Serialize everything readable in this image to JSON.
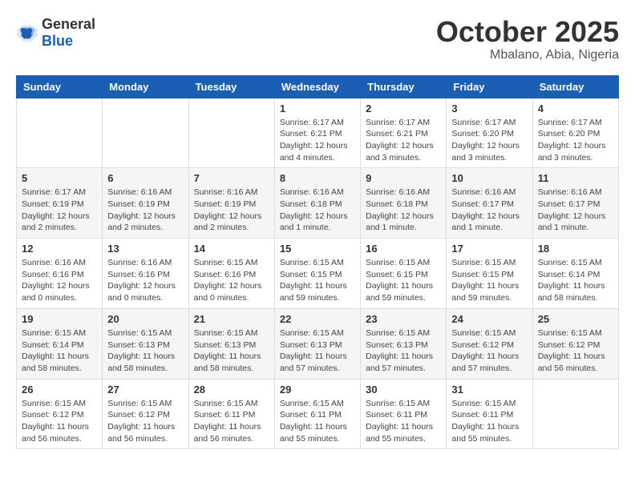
{
  "header": {
    "logo": {
      "general": "General",
      "blue": "Blue"
    },
    "title": "October 2025",
    "location": "Mbalano, Abia, Nigeria"
  },
  "calendar": {
    "weekdays": [
      "Sunday",
      "Monday",
      "Tuesday",
      "Wednesday",
      "Thursday",
      "Friday",
      "Saturday"
    ],
    "weeks": [
      [
        null,
        null,
        null,
        {
          "day": "1",
          "sunrise": "Sunrise: 6:17 AM",
          "sunset": "Sunset: 6:21 PM",
          "daylight": "Daylight: 12 hours and 4 minutes."
        },
        {
          "day": "2",
          "sunrise": "Sunrise: 6:17 AM",
          "sunset": "Sunset: 6:21 PM",
          "daylight": "Daylight: 12 hours and 3 minutes."
        },
        {
          "day": "3",
          "sunrise": "Sunrise: 6:17 AM",
          "sunset": "Sunset: 6:20 PM",
          "daylight": "Daylight: 12 hours and 3 minutes."
        },
        {
          "day": "4",
          "sunrise": "Sunrise: 6:17 AM",
          "sunset": "Sunset: 6:20 PM",
          "daylight": "Daylight: 12 hours and 3 minutes."
        }
      ],
      [
        {
          "day": "5",
          "sunrise": "Sunrise: 6:17 AM",
          "sunset": "Sunset: 6:19 PM",
          "daylight": "Daylight: 12 hours and 2 minutes."
        },
        {
          "day": "6",
          "sunrise": "Sunrise: 6:16 AM",
          "sunset": "Sunset: 6:19 PM",
          "daylight": "Daylight: 12 hours and 2 minutes."
        },
        {
          "day": "7",
          "sunrise": "Sunrise: 6:16 AM",
          "sunset": "Sunset: 6:19 PM",
          "daylight": "Daylight: 12 hours and 2 minutes."
        },
        {
          "day": "8",
          "sunrise": "Sunrise: 6:16 AM",
          "sunset": "Sunset: 6:18 PM",
          "daylight": "Daylight: 12 hours and 1 minute."
        },
        {
          "day": "9",
          "sunrise": "Sunrise: 6:16 AM",
          "sunset": "Sunset: 6:18 PM",
          "daylight": "Daylight: 12 hours and 1 minute."
        },
        {
          "day": "10",
          "sunrise": "Sunrise: 6:16 AM",
          "sunset": "Sunset: 6:17 PM",
          "daylight": "Daylight: 12 hours and 1 minute."
        },
        {
          "day": "11",
          "sunrise": "Sunrise: 6:16 AM",
          "sunset": "Sunset: 6:17 PM",
          "daylight": "Daylight: 12 hours and 1 minute."
        }
      ],
      [
        {
          "day": "12",
          "sunrise": "Sunrise: 6:16 AM",
          "sunset": "Sunset: 6:16 PM",
          "daylight": "Daylight: 12 hours and 0 minutes."
        },
        {
          "day": "13",
          "sunrise": "Sunrise: 6:16 AM",
          "sunset": "Sunset: 6:16 PM",
          "daylight": "Daylight: 12 hours and 0 minutes."
        },
        {
          "day": "14",
          "sunrise": "Sunrise: 6:15 AM",
          "sunset": "Sunset: 6:16 PM",
          "daylight": "Daylight: 12 hours and 0 minutes."
        },
        {
          "day": "15",
          "sunrise": "Sunrise: 6:15 AM",
          "sunset": "Sunset: 6:15 PM",
          "daylight": "Daylight: 11 hours and 59 minutes."
        },
        {
          "day": "16",
          "sunrise": "Sunrise: 6:15 AM",
          "sunset": "Sunset: 6:15 PM",
          "daylight": "Daylight: 11 hours and 59 minutes."
        },
        {
          "day": "17",
          "sunrise": "Sunrise: 6:15 AM",
          "sunset": "Sunset: 6:15 PM",
          "daylight": "Daylight: 11 hours and 59 minutes."
        },
        {
          "day": "18",
          "sunrise": "Sunrise: 6:15 AM",
          "sunset": "Sunset: 6:14 PM",
          "daylight": "Daylight: 11 hours and 58 minutes."
        }
      ],
      [
        {
          "day": "19",
          "sunrise": "Sunrise: 6:15 AM",
          "sunset": "Sunset: 6:14 PM",
          "daylight": "Daylight: 11 hours and 58 minutes."
        },
        {
          "day": "20",
          "sunrise": "Sunrise: 6:15 AM",
          "sunset": "Sunset: 6:13 PM",
          "daylight": "Daylight: 11 hours and 58 minutes."
        },
        {
          "day": "21",
          "sunrise": "Sunrise: 6:15 AM",
          "sunset": "Sunset: 6:13 PM",
          "daylight": "Daylight: 11 hours and 58 minutes."
        },
        {
          "day": "22",
          "sunrise": "Sunrise: 6:15 AM",
          "sunset": "Sunset: 6:13 PM",
          "daylight": "Daylight: 11 hours and 57 minutes."
        },
        {
          "day": "23",
          "sunrise": "Sunrise: 6:15 AM",
          "sunset": "Sunset: 6:13 PM",
          "daylight": "Daylight: 11 hours and 57 minutes."
        },
        {
          "day": "24",
          "sunrise": "Sunrise: 6:15 AM",
          "sunset": "Sunset: 6:12 PM",
          "daylight": "Daylight: 11 hours and 57 minutes."
        },
        {
          "day": "25",
          "sunrise": "Sunrise: 6:15 AM",
          "sunset": "Sunset: 6:12 PM",
          "daylight": "Daylight: 11 hours and 56 minutes."
        }
      ],
      [
        {
          "day": "26",
          "sunrise": "Sunrise: 6:15 AM",
          "sunset": "Sunset: 6:12 PM",
          "daylight": "Daylight: 11 hours and 56 minutes."
        },
        {
          "day": "27",
          "sunrise": "Sunrise: 6:15 AM",
          "sunset": "Sunset: 6:12 PM",
          "daylight": "Daylight: 11 hours and 56 minutes."
        },
        {
          "day": "28",
          "sunrise": "Sunrise: 6:15 AM",
          "sunset": "Sunset: 6:11 PM",
          "daylight": "Daylight: 11 hours and 56 minutes."
        },
        {
          "day": "29",
          "sunrise": "Sunrise: 6:15 AM",
          "sunset": "Sunset: 6:11 PM",
          "daylight": "Daylight: 11 hours and 55 minutes."
        },
        {
          "day": "30",
          "sunrise": "Sunrise: 6:15 AM",
          "sunset": "Sunset: 6:11 PM",
          "daylight": "Daylight: 11 hours and 55 minutes."
        },
        {
          "day": "31",
          "sunrise": "Sunrise: 6:15 AM",
          "sunset": "Sunset: 6:11 PM",
          "daylight": "Daylight: 11 hours and 55 minutes."
        },
        null
      ]
    ]
  }
}
